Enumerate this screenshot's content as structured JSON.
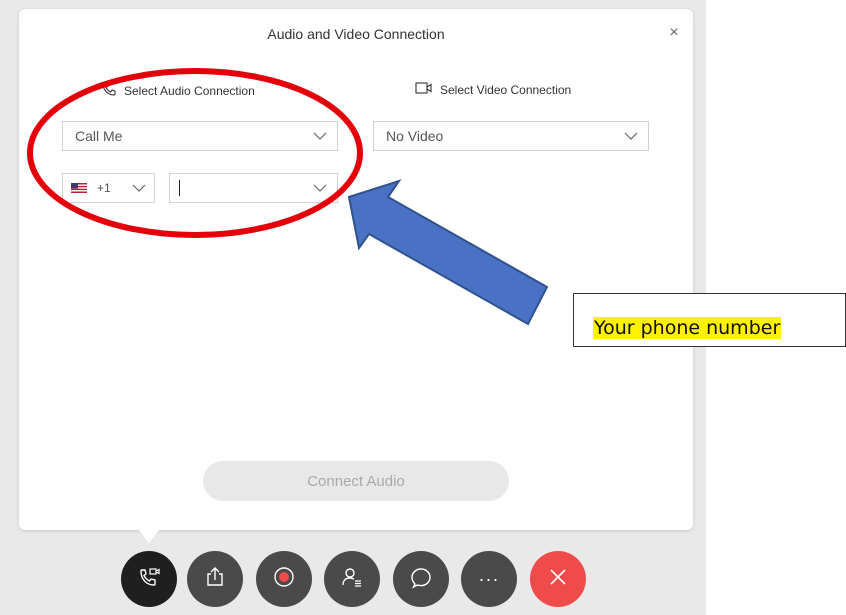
{
  "dialog": {
    "title": "Audio and Video Connection",
    "close_label": "×"
  },
  "audio": {
    "section_label": "Select Audio Connection",
    "connection_value": "Call Me",
    "country_code": "+1",
    "phone_value": ""
  },
  "video": {
    "section_label": "Select Video Connection",
    "connection_value": "No Video"
  },
  "connect_button_label": "Connect Audio",
  "toolbar": {
    "items": [
      "audio-video-icon",
      "share-icon",
      "record-icon",
      "participants-icon",
      "chat-icon",
      "more-icon",
      "end-call-icon"
    ],
    "more_label": "···",
    "end_label": "×"
  },
  "annotation": {
    "callout_text": "Your phone number",
    "circle_color": "#e3000b",
    "arrow_color": "#4a72c4"
  },
  "colors": {
    "end_call": "#f04b4b",
    "toolbar_button": "#4a4a4a",
    "toolbar_active": "#1f1f1f"
  }
}
